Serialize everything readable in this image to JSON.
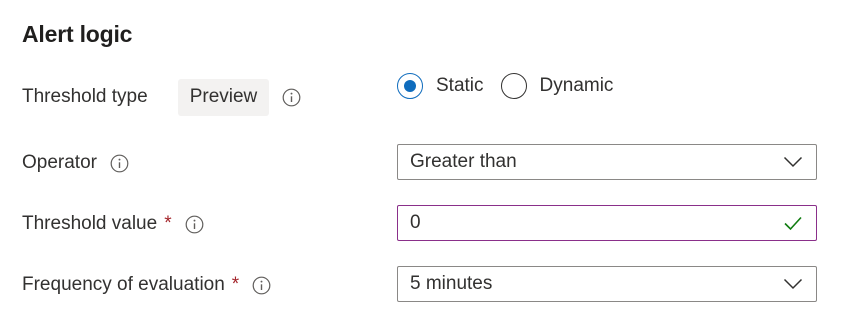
{
  "section": {
    "title": "Alert logic"
  },
  "threshold_type": {
    "label": "Threshold type",
    "badge": "Preview",
    "info_icon": "info-icon",
    "options": [
      {
        "label": "Static",
        "selected": true
      },
      {
        "label": "Dynamic",
        "selected": false
      }
    ]
  },
  "operator": {
    "label": "Operator",
    "info_icon": "info-icon",
    "value": "Greater than",
    "icon": "chevron-down-icon"
  },
  "threshold_value": {
    "label": "Threshold value",
    "required_mark": "*",
    "info_icon": "info-icon",
    "value": "0",
    "icon": "checkmark-icon"
  },
  "frequency": {
    "label": "Frequency of evaluation",
    "required_mark": "*",
    "info_icon": "info-icon",
    "value": "5 minutes",
    "icon": "chevron-down-icon"
  },
  "colors": {
    "accent": "#0f6cbd",
    "required": "#a4262c",
    "valid_border": "#8a2f8a",
    "success": "#107c10"
  }
}
